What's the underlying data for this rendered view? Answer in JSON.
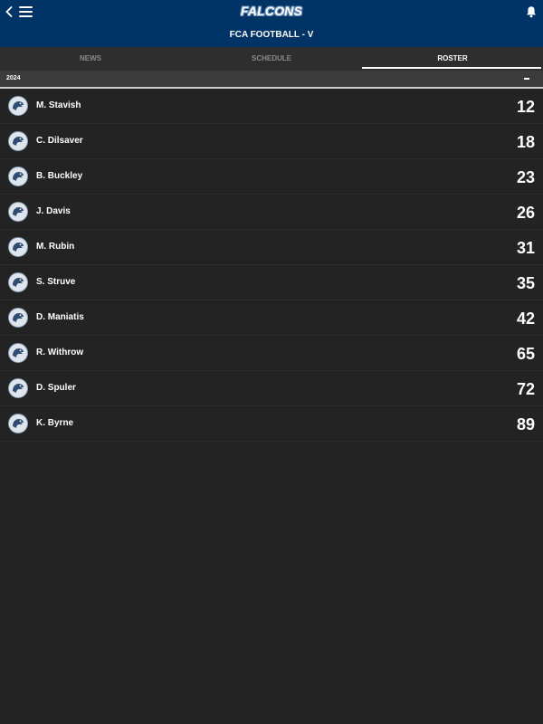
{
  "header": {
    "logo_text": "FALCONS",
    "title": "FCA FOOTBALL - V",
    "back_icon": "chevron-left-icon",
    "menu_icon": "hamburger-menu-icon",
    "bell_icon": "bell-icon",
    "background_color": "#003366"
  },
  "tabs": [
    {
      "label": "NEWS",
      "active": false
    },
    {
      "label": "SCHEDULE",
      "active": false
    },
    {
      "label": "ROSTER",
      "active": true
    }
  ],
  "season": {
    "label": "2024",
    "collapse_icon": "minus-icon"
  },
  "players": [
    {
      "name": "M. Stavish",
      "number": "12"
    },
    {
      "name": "C. Dilsaver",
      "number": "18"
    },
    {
      "name": "B. Buckley",
      "number": "23"
    },
    {
      "name": "J. Davis",
      "number": "26"
    },
    {
      "name": "M. Rubin",
      "number": "31"
    },
    {
      "name": "S. Struve",
      "number": "35"
    },
    {
      "name": "D. Maniatis",
      "number": "42"
    },
    {
      "name": "R. Withrow",
      "number": "65"
    },
    {
      "name": "D. Spuler",
      "number": "72"
    },
    {
      "name": "K. Byrne",
      "number": "89"
    }
  ]
}
